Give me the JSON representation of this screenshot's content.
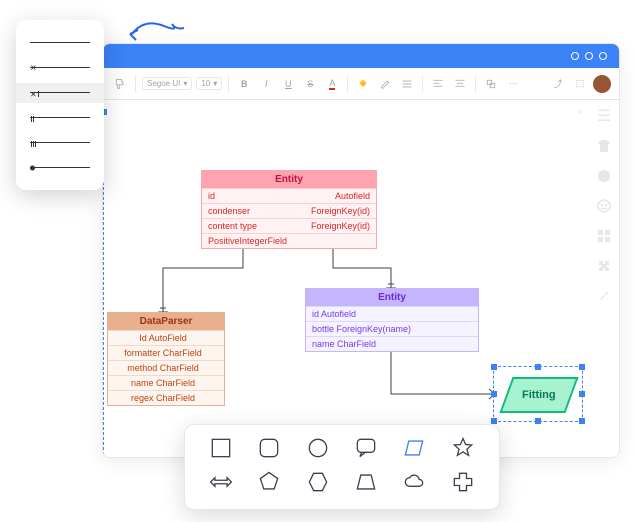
{
  "line_styles": [
    "none",
    "single",
    "double-selected",
    "triple",
    "double-spaced",
    "dot"
  ],
  "toolbar": {
    "font_family": "Segoe UI",
    "font_size": "10",
    "buttons": {
      "bold": "B",
      "italic": "I",
      "underline": "U",
      "strike": "S",
      "text_color": "A"
    }
  },
  "entities": {
    "pink": {
      "title": "Entity",
      "rows": [
        {
          "name": "id",
          "type": "Autofield"
        },
        {
          "name": "condenser",
          "type": "ForeignKey(id)"
        },
        {
          "name": "content type",
          "type": "ForeignKey(id)"
        },
        {
          "name": "PositiveIntegerField",
          "type": ""
        }
      ]
    },
    "brown": {
      "title": "DataParser",
      "rows": [
        {
          "name": "Id AutoField"
        },
        {
          "name": "formatter CharField"
        },
        {
          "name": "method CharField"
        },
        {
          "name": "name CharField"
        },
        {
          "name": "regex CharField"
        }
      ]
    },
    "purple": {
      "title": "Entity",
      "rows": [
        {
          "name": "id Autofield"
        },
        {
          "name": "bottle ForeignKey(name)"
        },
        {
          "name": "name CharField"
        }
      ]
    }
  },
  "fitting": {
    "label": "Fitting"
  },
  "shapes_row1": [
    "square",
    "rounded-square",
    "circle",
    "speech",
    "parallelogram",
    "star"
  ],
  "shapes_row2": [
    "double-arrow",
    "pentagon",
    "hexagon",
    "trapezoid",
    "cloud",
    "plus"
  ],
  "shape_selected": "parallelogram",
  "chart_data": {
    "type": "erd",
    "entities": [
      {
        "id": "pink",
        "name": "Entity",
        "color": "pink",
        "fields": [
          {
            "name": "id",
            "type": "Autofield"
          },
          {
            "name": "condenser",
            "type": "ForeignKey(id)"
          },
          {
            "name": "content type",
            "type": "ForeignKey(id)"
          },
          {
            "name": "PositiveIntegerField",
            "type": ""
          }
        ]
      },
      {
        "id": "dataparser",
        "name": "DataParser",
        "color": "brown",
        "fields": [
          {
            "name": "Id",
            "type": "AutoField"
          },
          {
            "name": "formatter",
            "type": "CharField"
          },
          {
            "name": "method",
            "type": "CharField"
          },
          {
            "name": "name",
            "type": "CharField"
          },
          {
            "name": "regex",
            "type": "CharField"
          }
        ]
      },
      {
        "id": "purple",
        "name": "Entity",
        "color": "purple",
        "fields": [
          {
            "name": "id",
            "type": "Autofield"
          },
          {
            "name": "bottle",
            "type": "ForeignKey(name)"
          },
          {
            "name": "name",
            "type": "CharField"
          }
        ]
      },
      {
        "id": "fitting",
        "name": "Fitting",
        "color": "green",
        "shape": "parallelogram"
      }
    ],
    "relationships": [
      {
        "from": "pink",
        "to": "dataparser"
      },
      {
        "from": "pink",
        "to": "purple"
      },
      {
        "from": "purple",
        "to": "fitting"
      }
    ]
  }
}
